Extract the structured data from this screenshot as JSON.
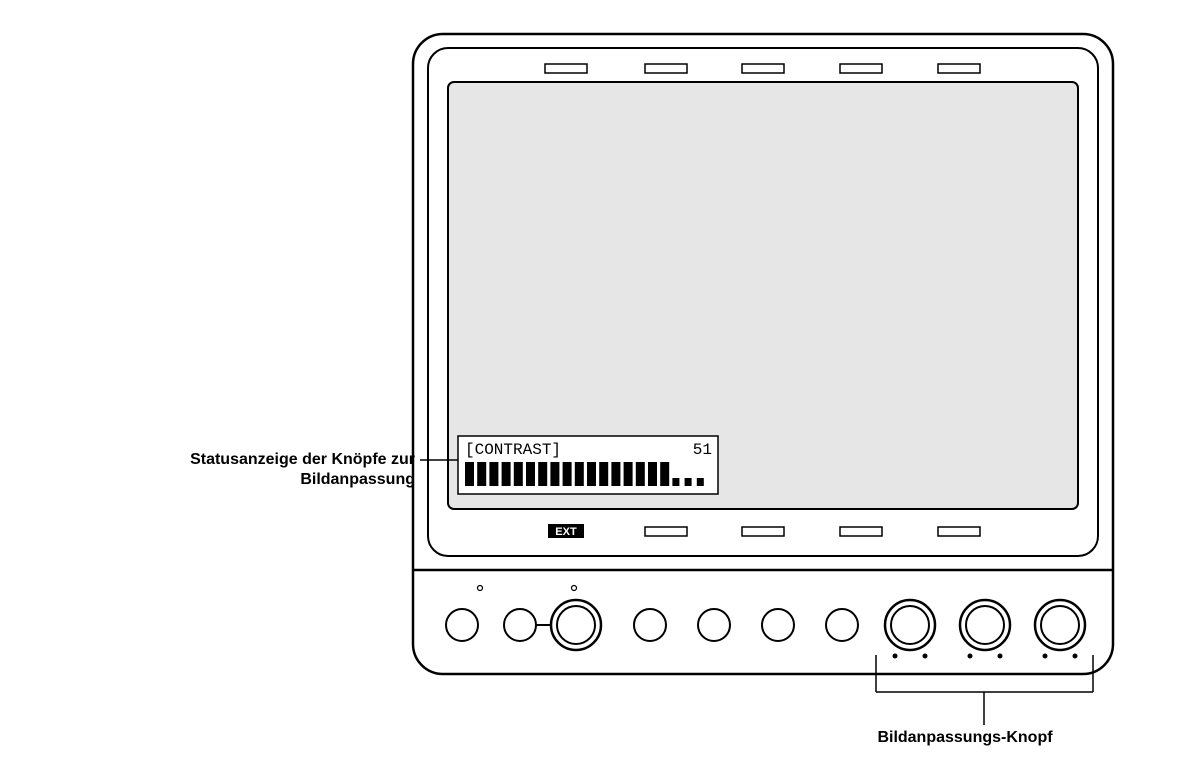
{
  "callouts": {
    "status_display_line1": "Statusanzeige der Knöpfe zur",
    "status_display_line2": "Bildanpassung",
    "adjust_knob": "Bildanpassungs-Knopf"
  },
  "osd": {
    "label": "[CONTRAST]",
    "value": "51",
    "bar_filled": 17,
    "bar_total": 20
  },
  "badge": "EXT"
}
